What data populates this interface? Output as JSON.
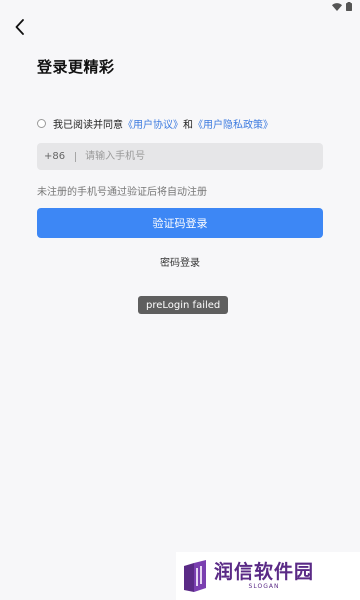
{
  "status_bar": {
    "icons": [
      "wifi-icon",
      "battery-icon"
    ]
  },
  "header": {
    "back_icon": "chevron-left-icon",
    "title": "登录更精彩"
  },
  "agreement": {
    "checked": false,
    "prefix": "我已阅读并同意",
    "user_agreement": "《用户协议》",
    "conjunction": "和",
    "privacy_policy": "《用户隐私政策》",
    "link_color": "#3d7be0"
  },
  "phone_field": {
    "country_code": "+86",
    "value": "",
    "placeholder": "请输入手机号"
  },
  "hint": "未注册的手机号通过验证后将自动注册",
  "buttons": {
    "sms_login": "验证码登录",
    "sms_login_color": "#3d87f5",
    "password_login": "密码登录"
  },
  "toast": {
    "message": "preLogin failed"
  },
  "watermark": {
    "name": "润信软件园",
    "slogan": "SLOGAN",
    "color": "#5a2a86"
  }
}
